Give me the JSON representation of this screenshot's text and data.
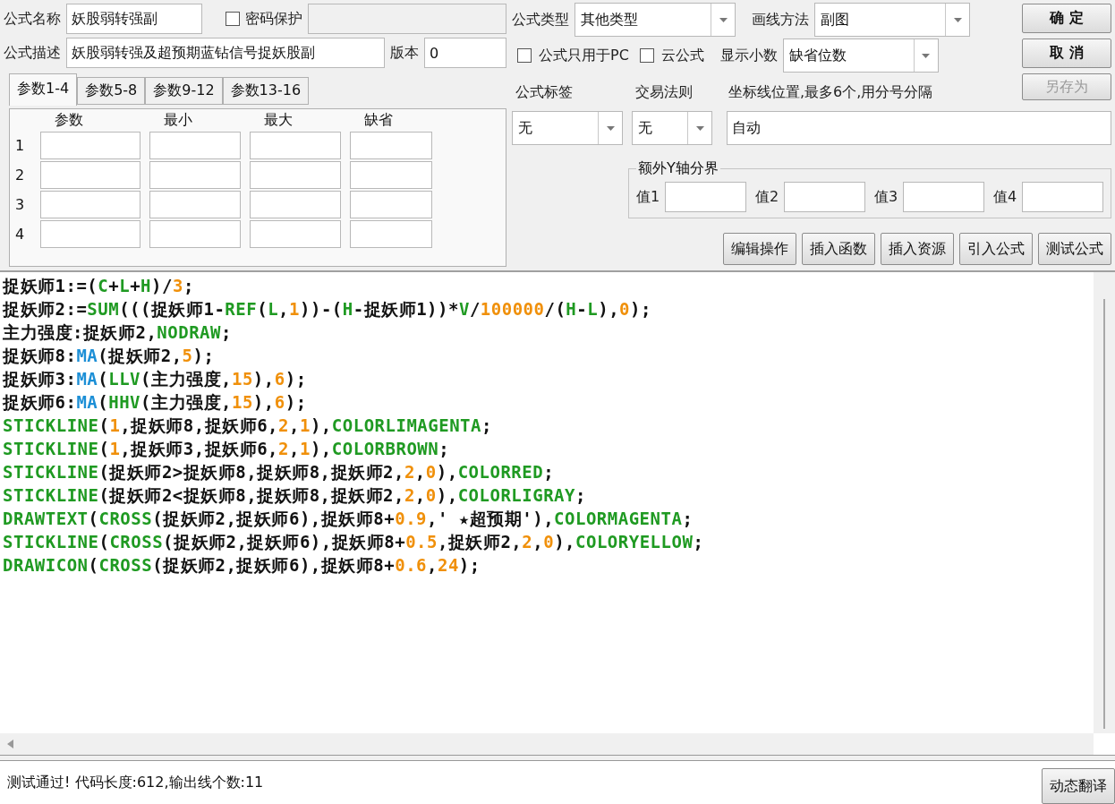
{
  "form": {
    "name_label": "公式名称",
    "name_value": "妖股弱转强副",
    "password": {
      "label": "密码保护",
      "checked": false
    },
    "description_label": "公式描述",
    "description_value": "妖股弱转强及超预期蓝钻信号捉妖股副",
    "version_label": "版本",
    "version_value": "0"
  },
  "param_tabs": [
    {
      "label": "参数1-4",
      "selected": true
    },
    {
      "label": "参数5-8",
      "selected": false
    },
    {
      "label": "参数9-12",
      "selected": false
    },
    {
      "label": "参数13-16",
      "selected": false
    }
  ],
  "param_table": {
    "columns": [
      "参数",
      "最小",
      "最大",
      "缺省"
    ],
    "rows": [
      "1",
      "2",
      "3",
      "4"
    ]
  },
  "formula_type": {
    "label": "公式类型",
    "value": "其他类型"
  },
  "draw_method": {
    "label": "画线方法",
    "value": "副图"
  },
  "options": [
    {
      "label": "公式只用于PC",
      "checked": false
    },
    {
      "label": "云公式",
      "checked": false
    }
  ],
  "decimals": {
    "label": "显示小数",
    "value": "缺省位数"
  },
  "actions": [
    {
      "label": "确 定",
      "disabled": false
    },
    {
      "label": "取 消",
      "disabled": false
    },
    {
      "label": "另存为",
      "disabled": true
    }
  ],
  "tag": {
    "label": "公式标签",
    "value": "无"
  },
  "trade_rule": {
    "label": "交易法则",
    "value": "无"
  },
  "axis_lines": {
    "label": "坐标线位置,最多6个,用分号分隔",
    "value": "自动"
  },
  "y_bounds": {
    "title": "额外Y轴分界",
    "fields": [
      "值1",
      "值2",
      "值3",
      "值4"
    ]
  },
  "tools": [
    "编辑操作",
    "插入函数",
    "插入资源",
    "引入公式",
    "测试公式"
  ],
  "code_lines": [
    [
      {
        "text": "捉妖师1:=(",
        "kind": "plain"
      },
      {
        "text": "C",
        "kind": "keyword"
      },
      {
        "text": "+",
        "kind": "plain"
      },
      {
        "text": "L",
        "kind": "keyword"
      },
      {
        "text": "+",
        "kind": "plain"
      },
      {
        "text": "H",
        "kind": "keyword"
      },
      {
        "text": ")/",
        "kind": "plain"
      },
      {
        "text": "3",
        "kind": "number"
      },
      {
        "text": ";",
        "kind": "plain"
      }
    ],
    [
      {
        "text": "捉妖师2:=",
        "kind": "plain"
      },
      {
        "text": "SUM",
        "kind": "keyword"
      },
      {
        "text": "(((捉妖师1-",
        "kind": "plain"
      },
      {
        "text": "REF",
        "kind": "keyword"
      },
      {
        "text": "(",
        "kind": "plain"
      },
      {
        "text": "L",
        "kind": "keyword"
      },
      {
        "text": ",",
        "kind": "plain"
      },
      {
        "text": "1",
        "kind": "number"
      },
      {
        "text": "))-(",
        "kind": "plain"
      },
      {
        "text": "H",
        "kind": "keyword"
      },
      {
        "text": "-捉妖师1))*",
        "kind": "plain"
      },
      {
        "text": "V",
        "kind": "keyword"
      },
      {
        "text": "/",
        "kind": "plain"
      },
      {
        "text": "100000",
        "kind": "number"
      },
      {
        "text": "/(",
        "kind": "plain"
      },
      {
        "text": "H",
        "kind": "keyword"
      },
      {
        "text": "-",
        "kind": "plain"
      },
      {
        "text": "L",
        "kind": "keyword"
      },
      {
        "text": "),",
        "kind": "plain"
      },
      {
        "text": "0",
        "kind": "number"
      },
      {
        "text": ");",
        "kind": "plain"
      }
    ],
    [
      {
        "text": "主力强度:捉妖师2,",
        "kind": "plain"
      },
      {
        "text": "NODRAW",
        "kind": "keyword"
      },
      {
        "text": ";",
        "kind": "plain"
      }
    ],
    [
      {
        "text": "捉妖师8:",
        "kind": "plain"
      },
      {
        "text": "MA",
        "kind": "function"
      },
      {
        "text": "(捉妖师2,",
        "kind": "plain"
      },
      {
        "text": "5",
        "kind": "number"
      },
      {
        "text": ");",
        "kind": "plain"
      }
    ],
    [
      {
        "text": "捉妖师3:",
        "kind": "plain"
      },
      {
        "text": "MA",
        "kind": "function"
      },
      {
        "text": "(",
        "kind": "plain"
      },
      {
        "text": "LLV",
        "kind": "keyword"
      },
      {
        "text": "(主力强度,",
        "kind": "plain"
      },
      {
        "text": "15",
        "kind": "number"
      },
      {
        "text": "),",
        "kind": "plain"
      },
      {
        "text": "6",
        "kind": "number"
      },
      {
        "text": ");",
        "kind": "plain"
      }
    ],
    [
      {
        "text": "捉妖师6:",
        "kind": "plain"
      },
      {
        "text": "MA",
        "kind": "function"
      },
      {
        "text": "(",
        "kind": "plain"
      },
      {
        "text": "HHV",
        "kind": "keyword"
      },
      {
        "text": "(主力强度,",
        "kind": "plain"
      },
      {
        "text": "15",
        "kind": "number"
      },
      {
        "text": "),",
        "kind": "plain"
      },
      {
        "text": "6",
        "kind": "number"
      },
      {
        "text": ");",
        "kind": "plain"
      }
    ],
    [
      {
        "text": "STICKLINE",
        "kind": "keyword"
      },
      {
        "text": "(",
        "kind": "plain"
      },
      {
        "text": "1",
        "kind": "number"
      },
      {
        "text": ",捉妖师8,捉妖师6,",
        "kind": "plain"
      },
      {
        "text": "2",
        "kind": "number"
      },
      {
        "text": ",",
        "kind": "plain"
      },
      {
        "text": "1",
        "kind": "number"
      },
      {
        "text": "),",
        "kind": "plain"
      },
      {
        "text": "COLORLIMAGENTA",
        "kind": "keyword"
      },
      {
        "text": ";",
        "kind": "plain"
      }
    ],
    [
      {
        "text": "STICKLINE",
        "kind": "keyword"
      },
      {
        "text": "(",
        "kind": "plain"
      },
      {
        "text": "1",
        "kind": "number"
      },
      {
        "text": ",捉妖师3,捉妖师6,",
        "kind": "plain"
      },
      {
        "text": "2",
        "kind": "number"
      },
      {
        "text": ",",
        "kind": "plain"
      },
      {
        "text": "1",
        "kind": "number"
      },
      {
        "text": "),",
        "kind": "plain"
      },
      {
        "text": "COLORBROWN",
        "kind": "keyword"
      },
      {
        "text": ";",
        "kind": "plain"
      }
    ],
    [
      {
        "text": "STICKLINE",
        "kind": "keyword"
      },
      {
        "text": "(捉妖师2>捉妖师8,捉妖师8,捉妖师2,",
        "kind": "plain"
      },
      {
        "text": "2",
        "kind": "number"
      },
      {
        "text": ",",
        "kind": "plain"
      },
      {
        "text": "0",
        "kind": "number"
      },
      {
        "text": "),",
        "kind": "plain"
      },
      {
        "text": "COLORRED",
        "kind": "keyword"
      },
      {
        "text": ";",
        "kind": "plain"
      }
    ],
    [
      {
        "text": "STICKLINE",
        "kind": "keyword"
      },
      {
        "text": "(捉妖师2<捉妖师8,捉妖师8,捉妖师2,",
        "kind": "plain"
      },
      {
        "text": "2",
        "kind": "number"
      },
      {
        "text": ",",
        "kind": "plain"
      },
      {
        "text": "0",
        "kind": "number"
      },
      {
        "text": "),",
        "kind": "plain"
      },
      {
        "text": "COLORLIGRAY",
        "kind": "keyword"
      },
      {
        "text": ";",
        "kind": "plain"
      }
    ],
    [
      {
        "text": "DRAWTEXT",
        "kind": "keyword"
      },
      {
        "text": "(",
        "kind": "plain"
      },
      {
        "text": "CROSS",
        "kind": "keyword"
      },
      {
        "text": "(捉妖师2,捉妖师6),捉妖师8+",
        "kind": "plain"
      },
      {
        "text": "0.9",
        "kind": "number"
      },
      {
        "text": ",' ★超预期'),",
        "kind": "plain"
      },
      {
        "text": "COLORMAGENTA",
        "kind": "keyword"
      },
      {
        "text": ";",
        "kind": "plain"
      }
    ],
    [
      {
        "text": "STICKLINE",
        "kind": "keyword"
      },
      {
        "text": "(",
        "kind": "plain"
      },
      {
        "text": "CROSS",
        "kind": "keyword"
      },
      {
        "text": "(捉妖师2,捉妖师6),捉妖师8+",
        "kind": "plain"
      },
      {
        "text": "0.5",
        "kind": "number"
      },
      {
        "text": ",捉妖师2,",
        "kind": "plain"
      },
      {
        "text": "2",
        "kind": "number"
      },
      {
        "text": ",",
        "kind": "plain"
      },
      {
        "text": "0",
        "kind": "number"
      },
      {
        "text": "),",
        "kind": "plain"
      },
      {
        "text": "COLORYELLOW",
        "kind": "keyword"
      },
      {
        "text": ";",
        "kind": "plain"
      }
    ],
    [
      {
        "text": "DRAWICON",
        "kind": "keyword"
      },
      {
        "text": "(",
        "kind": "plain"
      },
      {
        "text": "CROSS",
        "kind": "keyword"
      },
      {
        "text": "(捉妖师2,捉妖师6),捉妖师8+",
        "kind": "plain"
      },
      {
        "text": "0.6",
        "kind": "number"
      },
      {
        "text": ",",
        "kind": "plain"
      },
      {
        "text": "24",
        "kind": "number"
      },
      {
        "text": ");",
        "kind": "plain"
      }
    ]
  ],
  "status": {
    "message": "测试通过! 代码长度:612,输出线个数:11",
    "button": "动态翻译"
  }
}
